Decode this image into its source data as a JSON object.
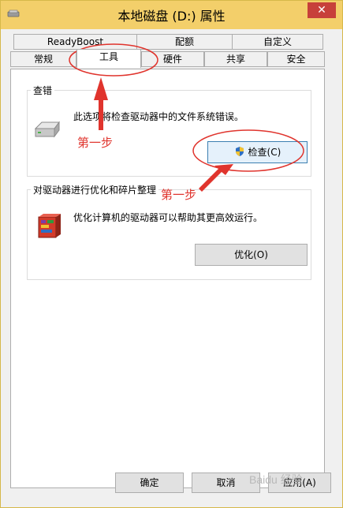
{
  "window": {
    "title": "本地磁盘 (D:) 属性",
    "close_label": "✕"
  },
  "tabs_row1": [
    "ReadyBoost",
    "配额",
    "自定义"
  ],
  "tabs_row2": [
    "常规",
    "工具",
    "硬件",
    "共享",
    "安全"
  ],
  "selected_tab": "工具",
  "error_check": {
    "group_label": "查错",
    "description": "此选项将检查驱动器中的文件系统错误。",
    "button_label": "检查(C)"
  },
  "optimize": {
    "group_label": "对驱动器进行优化和碎片整理",
    "description": "优化计算机的驱动器可以帮助其更高效运行。",
    "button_label": "优化(O)"
  },
  "footer": {
    "ok_label": "确定",
    "cancel_label": "取消",
    "apply_label": "应用(A)"
  },
  "annotations": {
    "step1": "第一步",
    "step2": "第一步"
  },
  "watermark": "Baidu 经验",
  "colors": {
    "annotation_red": "#e0342d",
    "title_bar": "#f3cf6a",
    "close_red": "#c7403a"
  }
}
